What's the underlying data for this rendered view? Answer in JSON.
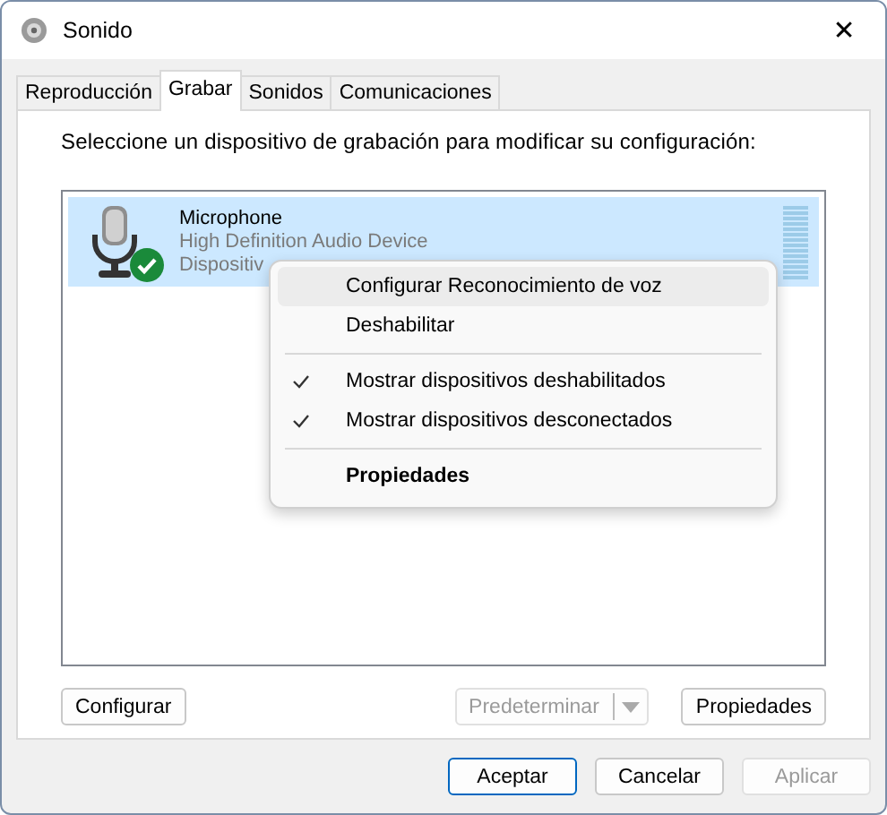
{
  "window": {
    "title": "Sonido",
    "close": "✕"
  },
  "tabs": [
    {
      "label": "Reproducción",
      "selected": false
    },
    {
      "label": "Grabar",
      "selected": true
    },
    {
      "label": "Sonidos",
      "selected": false
    },
    {
      "label": "Comunicaciones",
      "selected": false
    }
  ],
  "instruction": "Seleccione un dispositivo de grabación para modificar su configuración:",
  "devices": [
    {
      "name": "Microphone",
      "driver": "High Definition Audio Device",
      "status": "Dispositiv",
      "selected": true,
      "is_default": true,
      "level": 0
    }
  ],
  "context_menu": {
    "sections": [
      [
        {
          "label": "Configurar Reconocimiento de voz",
          "checked": false,
          "selected": true,
          "is_default": false
        },
        {
          "label": "Deshabilitar",
          "checked": false,
          "selected": false,
          "is_default": false
        }
      ],
      [
        {
          "label": "Mostrar dispositivos deshabilitados",
          "checked": true,
          "selected": false,
          "is_default": false
        },
        {
          "label": "Mostrar dispositivos desconectados",
          "checked": true,
          "selected": false,
          "is_default": false
        }
      ],
      [
        {
          "label": "Propiedades",
          "checked": false,
          "selected": false,
          "is_default": true
        }
      ]
    ]
  },
  "device_buttons": [
    {
      "kind": "button",
      "label": "Configurar",
      "disabled": false
    },
    {
      "kind": "split",
      "label": "Predeterminar",
      "disabled": true
    },
    {
      "kind": "button",
      "label": "Propiedades",
      "disabled": false
    }
  ],
  "dialog_buttons": [
    {
      "label": "Aceptar",
      "disabled": false,
      "is_default": true
    },
    {
      "label": "Cancelar",
      "disabled": false,
      "is_default": false
    },
    {
      "label": "Aplicar",
      "disabled": true,
      "is_default": false
    }
  ]
}
